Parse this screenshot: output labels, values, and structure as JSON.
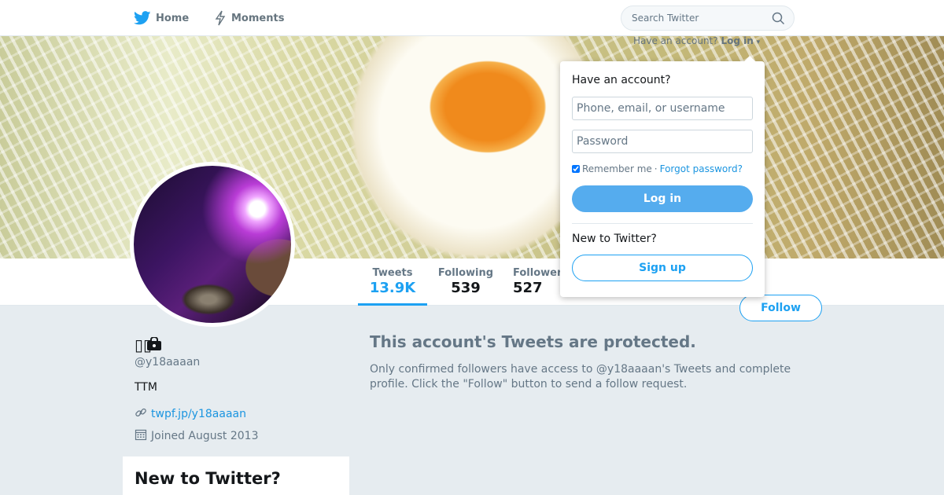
{
  "nav": {
    "home_label": "Home",
    "moments_label": "Moments",
    "search_placeholder": "Search Twitter",
    "login_hint_text": "Have an account?",
    "login_hint_link": "Log in"
  },
  "profile": {
    "name": "▯▯",
    "handle": "@y18aaaan",
    "bio": "TTM",
    "url": "twpf.jp/y18aaaan",
    "joined": "Joined August 2013"
  },
  "stats": {
    "tweets_label": "Tweets",
    "tweets_value": "13.9K",
    "following_label": "Following",
    "following_value": "539",
    "followers_label": "Followers",
    "followers_value": "527"
  },
  "follow_button": "Follow",
  "protected": {
    "title": "This account's Tweets are protected.",
    "body": "Only confirmed followers have access to @y18aaaan's Tweets and complete profile. Click the \"Follow\" button to send a follow request."
  },
  "sidebar_box": {
    "title": "New to Twitter?"
  },
  "login_dropdown": {
    "title": "Have an account?",
    "username_placeholder": "Phone, email, or username",
    "password_placeholder": "Password",
    "remember_label": "Remember me",
    "separator": "·",
    "forgot_link": "Forgot password?",
    "login_button": "Log in",
    "new_label": "New to Twitter?",
    "signup_button": "Sign up"
  },
  "colors": {
    "accent": "#1da1f2",
    "login_button": "#55acee",
    "background": "#e6ecf0"
  },
  "icons": [
    "twitter-bird-icon",
    "moments-bolt-icon",
    "search-icon",
    "lock-icon",
    "link-icon",
    "calendar-icon"
  ]
}
